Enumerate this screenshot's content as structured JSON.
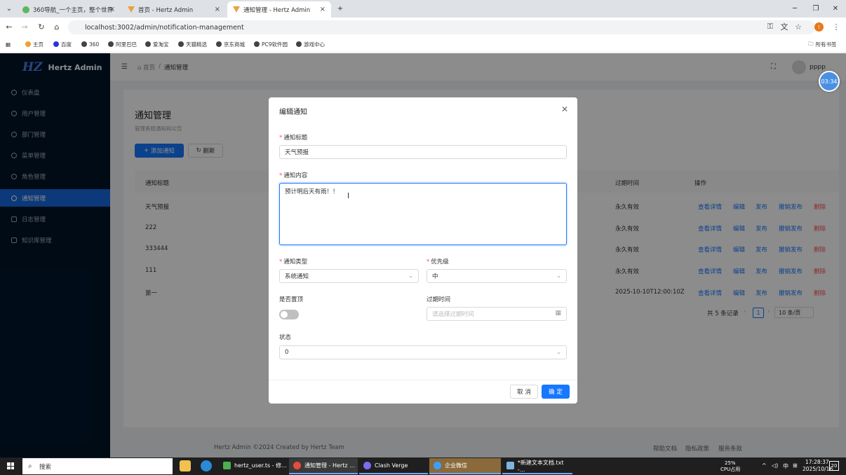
{
  "browser": {
    "tabs": [
      {
        "title": "360导航_一个主页，整个世界"
      },
      {
        "title": "首页 - Hertz Admin"
      },
      {
        "title": "通知管理 - Hertz Admin"
      }
    ],
    "url": "localhost:3002/admin/notification-management",
    "bookmarks": [
      "主页",
      "百度",
      "360",
      "阿里巴巴",
      "爱淘宝",
      "天猫精选",
      "京东商城",
      "PC9软件园",
      "游戏中心"
    ],
    "all_bookmarks": "所有书签",
    "new_tab": "+"
  },
  "app": {
    "brand": "Hertz Admin",
    "brand_mark": "HZ",
    "menu": [
      "仪表盘",
      "用户管理",
      "部门管理",
      "菜单管理",
      "角色管理",
      "通知管理",
      "日志管理",
      "知识库管理"
    ],
    "breadcrumb": {
      "home": "首页",
      "sep": "/",
      "current": "通知管理"
    },
    "user": "pppp",
    "timer": "03:34"
  },
  "page": {
    "title": "通知管理",
    "subtitle": "管理系统通知和公告",
    "add_button": "添加通知",
    "refresh_button": "刷新",
    "columns": {
      "title": "通知标题",
      "expire": "过期时间",
      "ops": "操作"
    },
    "rows": [
      {
        "title": "天气预报",
        "expire": "永久有效"
      },
      {
        "title": "222",
        "expire": "永久有效"
      },
      {
        "title": "333444",
        "expire": "永久有效"
      },
      {
        "title": "111",
        "expire": "永久有效"
      },
      {
        "title": "第一",
        "expire": "2025-10-10T12:00:10Z"
      }
    ],
    "actions": [
      "查看详情",
      "编辑",
      "发布",
      "撤销发布",
      "删除"
    ],
    "pagination": {
      "total": "共 5 条记录",
      "page": "1",
      "size": "10 条/页"
    },
    "footer": "Hertz Admin ©2024 Created by Hertz Team",
    "footer_links": [
      "帮助文档",
      "隐私政策",
      "服务条款"
    ]
  },
  "modal": {
    "title": "编辑通知",
    "fields": {
      "title_label": "通知标题",
      "title_value": "天气预报",
      "content_label": "通知内容",
      "content_value": "预计明后天有雨！！",
      "type_label": "通知类型",
      "type_value": "系统通知",
      "priority_label": "优先级",
      "priority_value": "中",
      "pinned_label": "是否置顶",
      "expire_label": "过期时间",
      "expire_placeholder": "请选择过期时间",
      "status_label": "状态",
      "status_value": "0"
    },
    "pinned": false,
    "cancel": "取 消",
    "ok": "确 定"
  },
  "taskbar": {
    "search": "搜索",
    "apps": [
      "hertz_user.ts - 修...",
      "通知管理 - Hertz ...",
      "Clash Verge",
      "企业微信",
      "*新建文本文档.txt -..."
    ],
    "cpu_pct": "25%",
    "cpu_label": "CPU占用",
    "ime": "中",
    "time": "17:28:37",
    "date": "2025/10/16",
    "notif_count": "20"
  },
  "colors": {
    "primary": "#1677ff",
    "sidebar": "#001529",
    "danger": "#ff4d4f"
  }
}
